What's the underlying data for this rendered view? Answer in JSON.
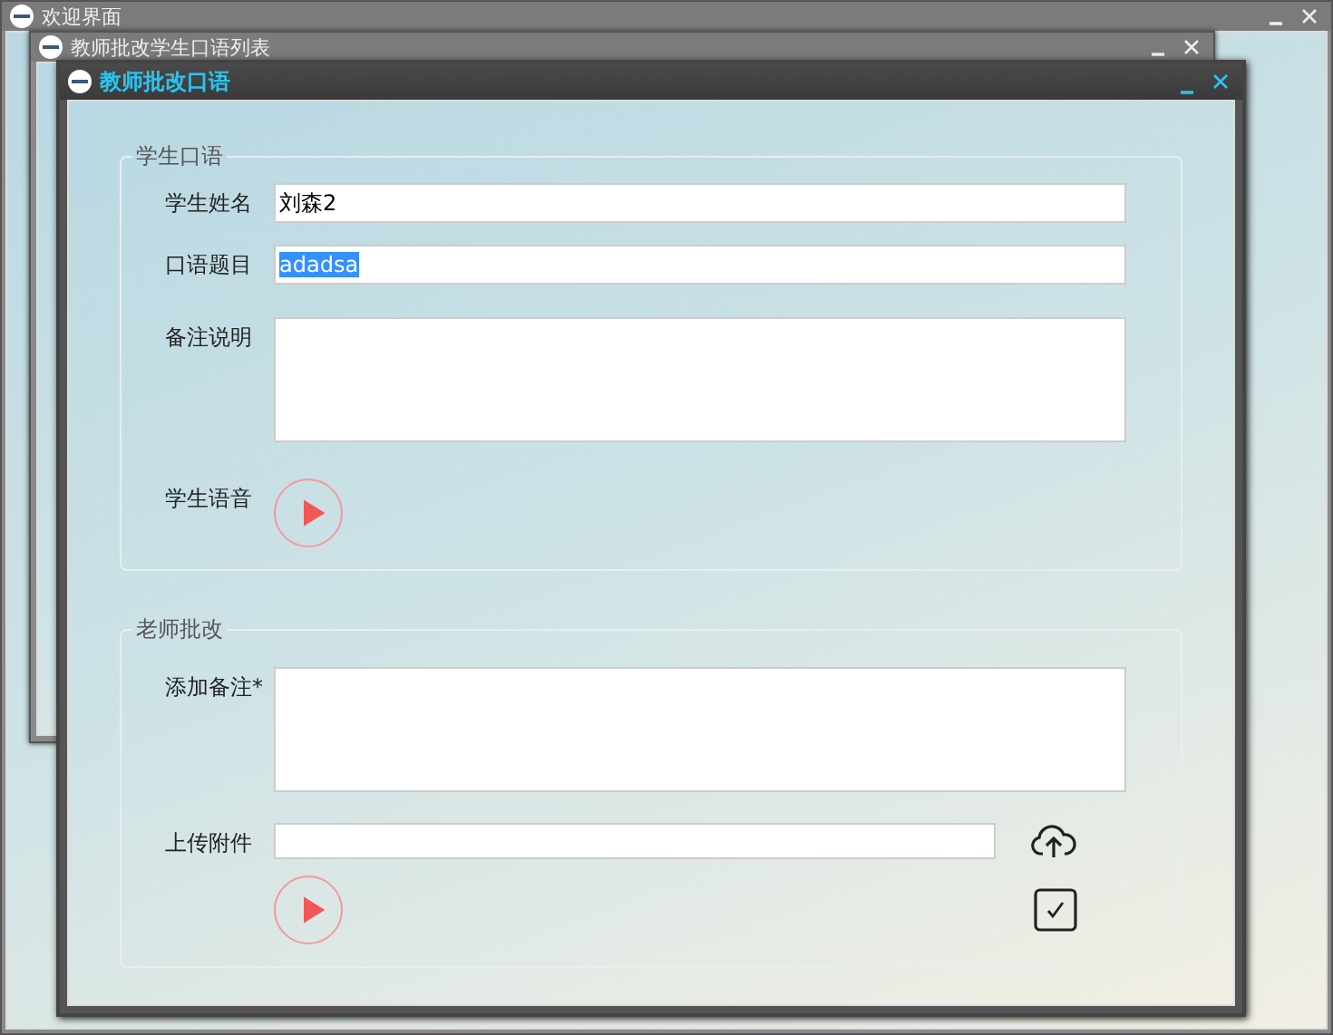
{
  "windows": [
    {
      "title": "欢迎界面",
      "active": false
    },
    {
      "title": "教师批改学生口语列表",
      "active": false
    },
    {
      "title": "教师批改口语",
      "active": true
    }
  ],
  "student_section": {
    "legend": "学生口语",
    "fields": [
      {
        "kind": "text",
        "label": "学生姓名",
        "value": "刘森2",
        "text_selected": false
      },
      {
        "kind": "text",
        "label": "口语题目",
        "value": "adadsa",
        "text_selected": true
      },
      {
        "kind": "textarea",
        "label": "备注说明"
      },
      {
        "kind": "audio",
        "label": "学生语音"
      }
    ]
  },
  "teacher_section": {
    "legend": "老师批改",
    "fields": [
      {
        "kind": "textarea",
        "label": "添加备注*"
      },
      {
        "kind": "upload",
        "label": "上传附件"
      },
      {
        "kind": "audio_confirm"
      }
    ]
  }
}
